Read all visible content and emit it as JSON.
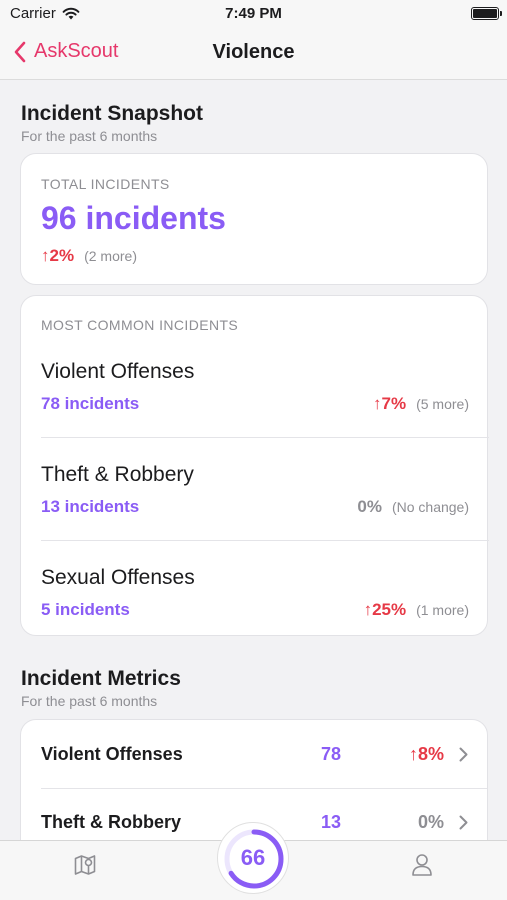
{
  "status": {
    "carrier": "Carrier",
    "time": "7:49 PM"
  },
  "nav": {
    "back_label": "AskScout",
    "title": "Violence"
  },
  "snapshot": {
    "title": "Incident Snapshot",
    "subtitle": "For the past 6 months",
    "total": {
      "label": "TOTAL INCIDENTS",
      "count": "96 incidents",
      "change": "↑2%",
      "change_note": "(2 more)"
    },
    "common": {
      "label": "MOST COMMON INCIDENTS",
      "items": [
        {
          "name": "Violent Offenses",
          "count": "78 incidents",
          "change": "↑7%",
          "note": "(5 more)",
          "trend": "up"
        },
        {
          "name": "Theft & Robbery",
          "count": "13 incidents",
          "change": "0%",
          "note": "(No change)",
          "trend": "flat"
        },
        {
          "name": "Sexual Offenses",
          "count": "5 incidents",
          "change": "↑25%",
          "note": "(1 more)",
          "trend": "up"
        }
      ]
    }
  },
  "metrics": {
    "title": "Incident Metrics",
    "subtitle": "For the past 6 months",
    "rows": [
      {
        "name": "Violent Offenses",
        "count": "78",
        "change": "↑8%",
        "trend": "up"
      },
      {
        "name": "Theft & Robbery",
        "count": "13",
        "change": "0%",
        "trend": "flat"
      }
    ]
  },
  "tabbar": {
    "score": "66",
    "score_fraction": 0.66
  },
  "colors": {
    "accent": "#8a5cf5",
    "brand": "#e6386b",
    "up": "#e63946",
    "flat": "#8e8e93"
  },
  "icons": [
    "wifi-icon",
    "battery-icon",
    "chevron-left-icon",
    "chevron-right-icon",
    "map-icon",
    "profile-icon"
  ]
}
